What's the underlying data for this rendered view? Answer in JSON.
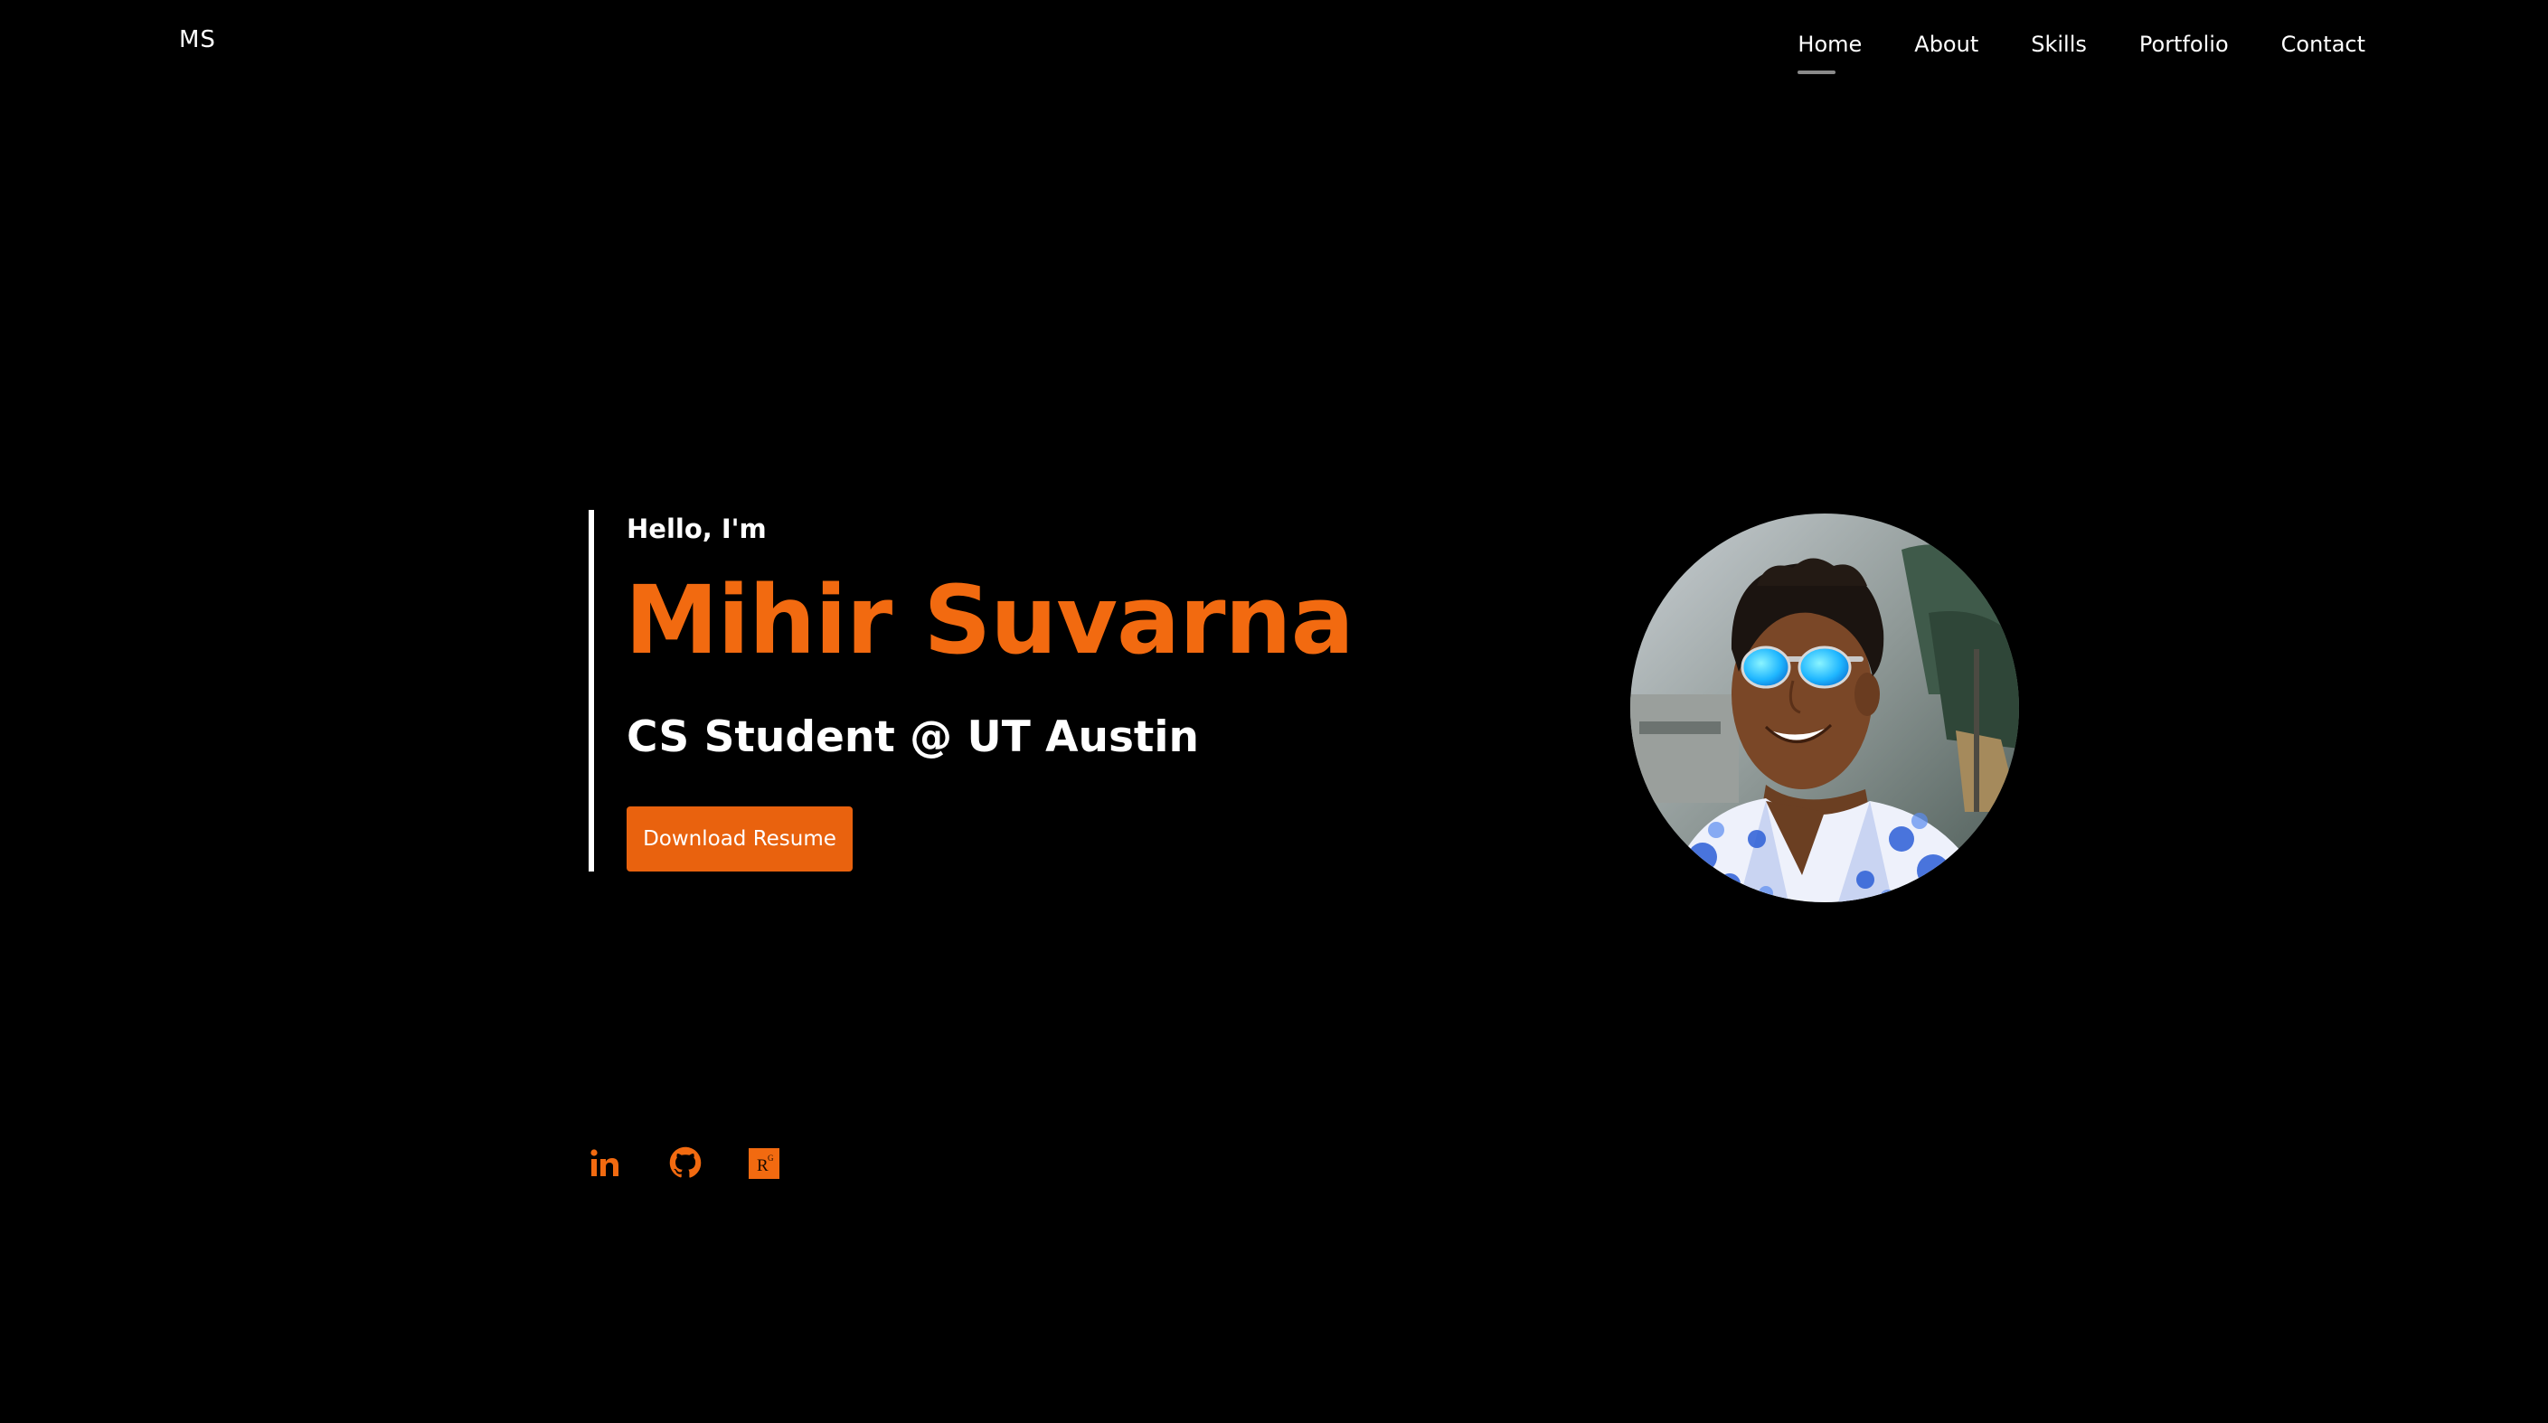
{
  "header": {
    "logo": "MS",
    "nav": [
      {
        "label": "Home",
        "active": true
      },
      {
        "label": "About",
        "active": false
      },
      {
        "label": "Skills",
        "active": false
      },
      {
        "label": "Portfolio",
        "active": false
      },
      {
        "label": "Contact",
        "active": false
      }
    ]
  },
  "hero": {
    "greeting": "Hello, I'm",
    "name": "Mihir Suvarna",
    "tagline": "CS Student @ UT Austin",
    "resume_button": "Download Resume"
  },
  "socials": [
    {
      "icon": "linkedin-icon",
      "label": "in"
    },
    {
      "icon": "github-icon"
    },
    {
      "icon": "researchgate-icon",
      "label": "R"
    }
  ],
  "colors": {
    "background": "#000000",
    "accent": "#f26a10",
    "button": "#e9620e",
    "text": "#ffffff",
    "nav_underline": "#8a8a8a"
  }
}
